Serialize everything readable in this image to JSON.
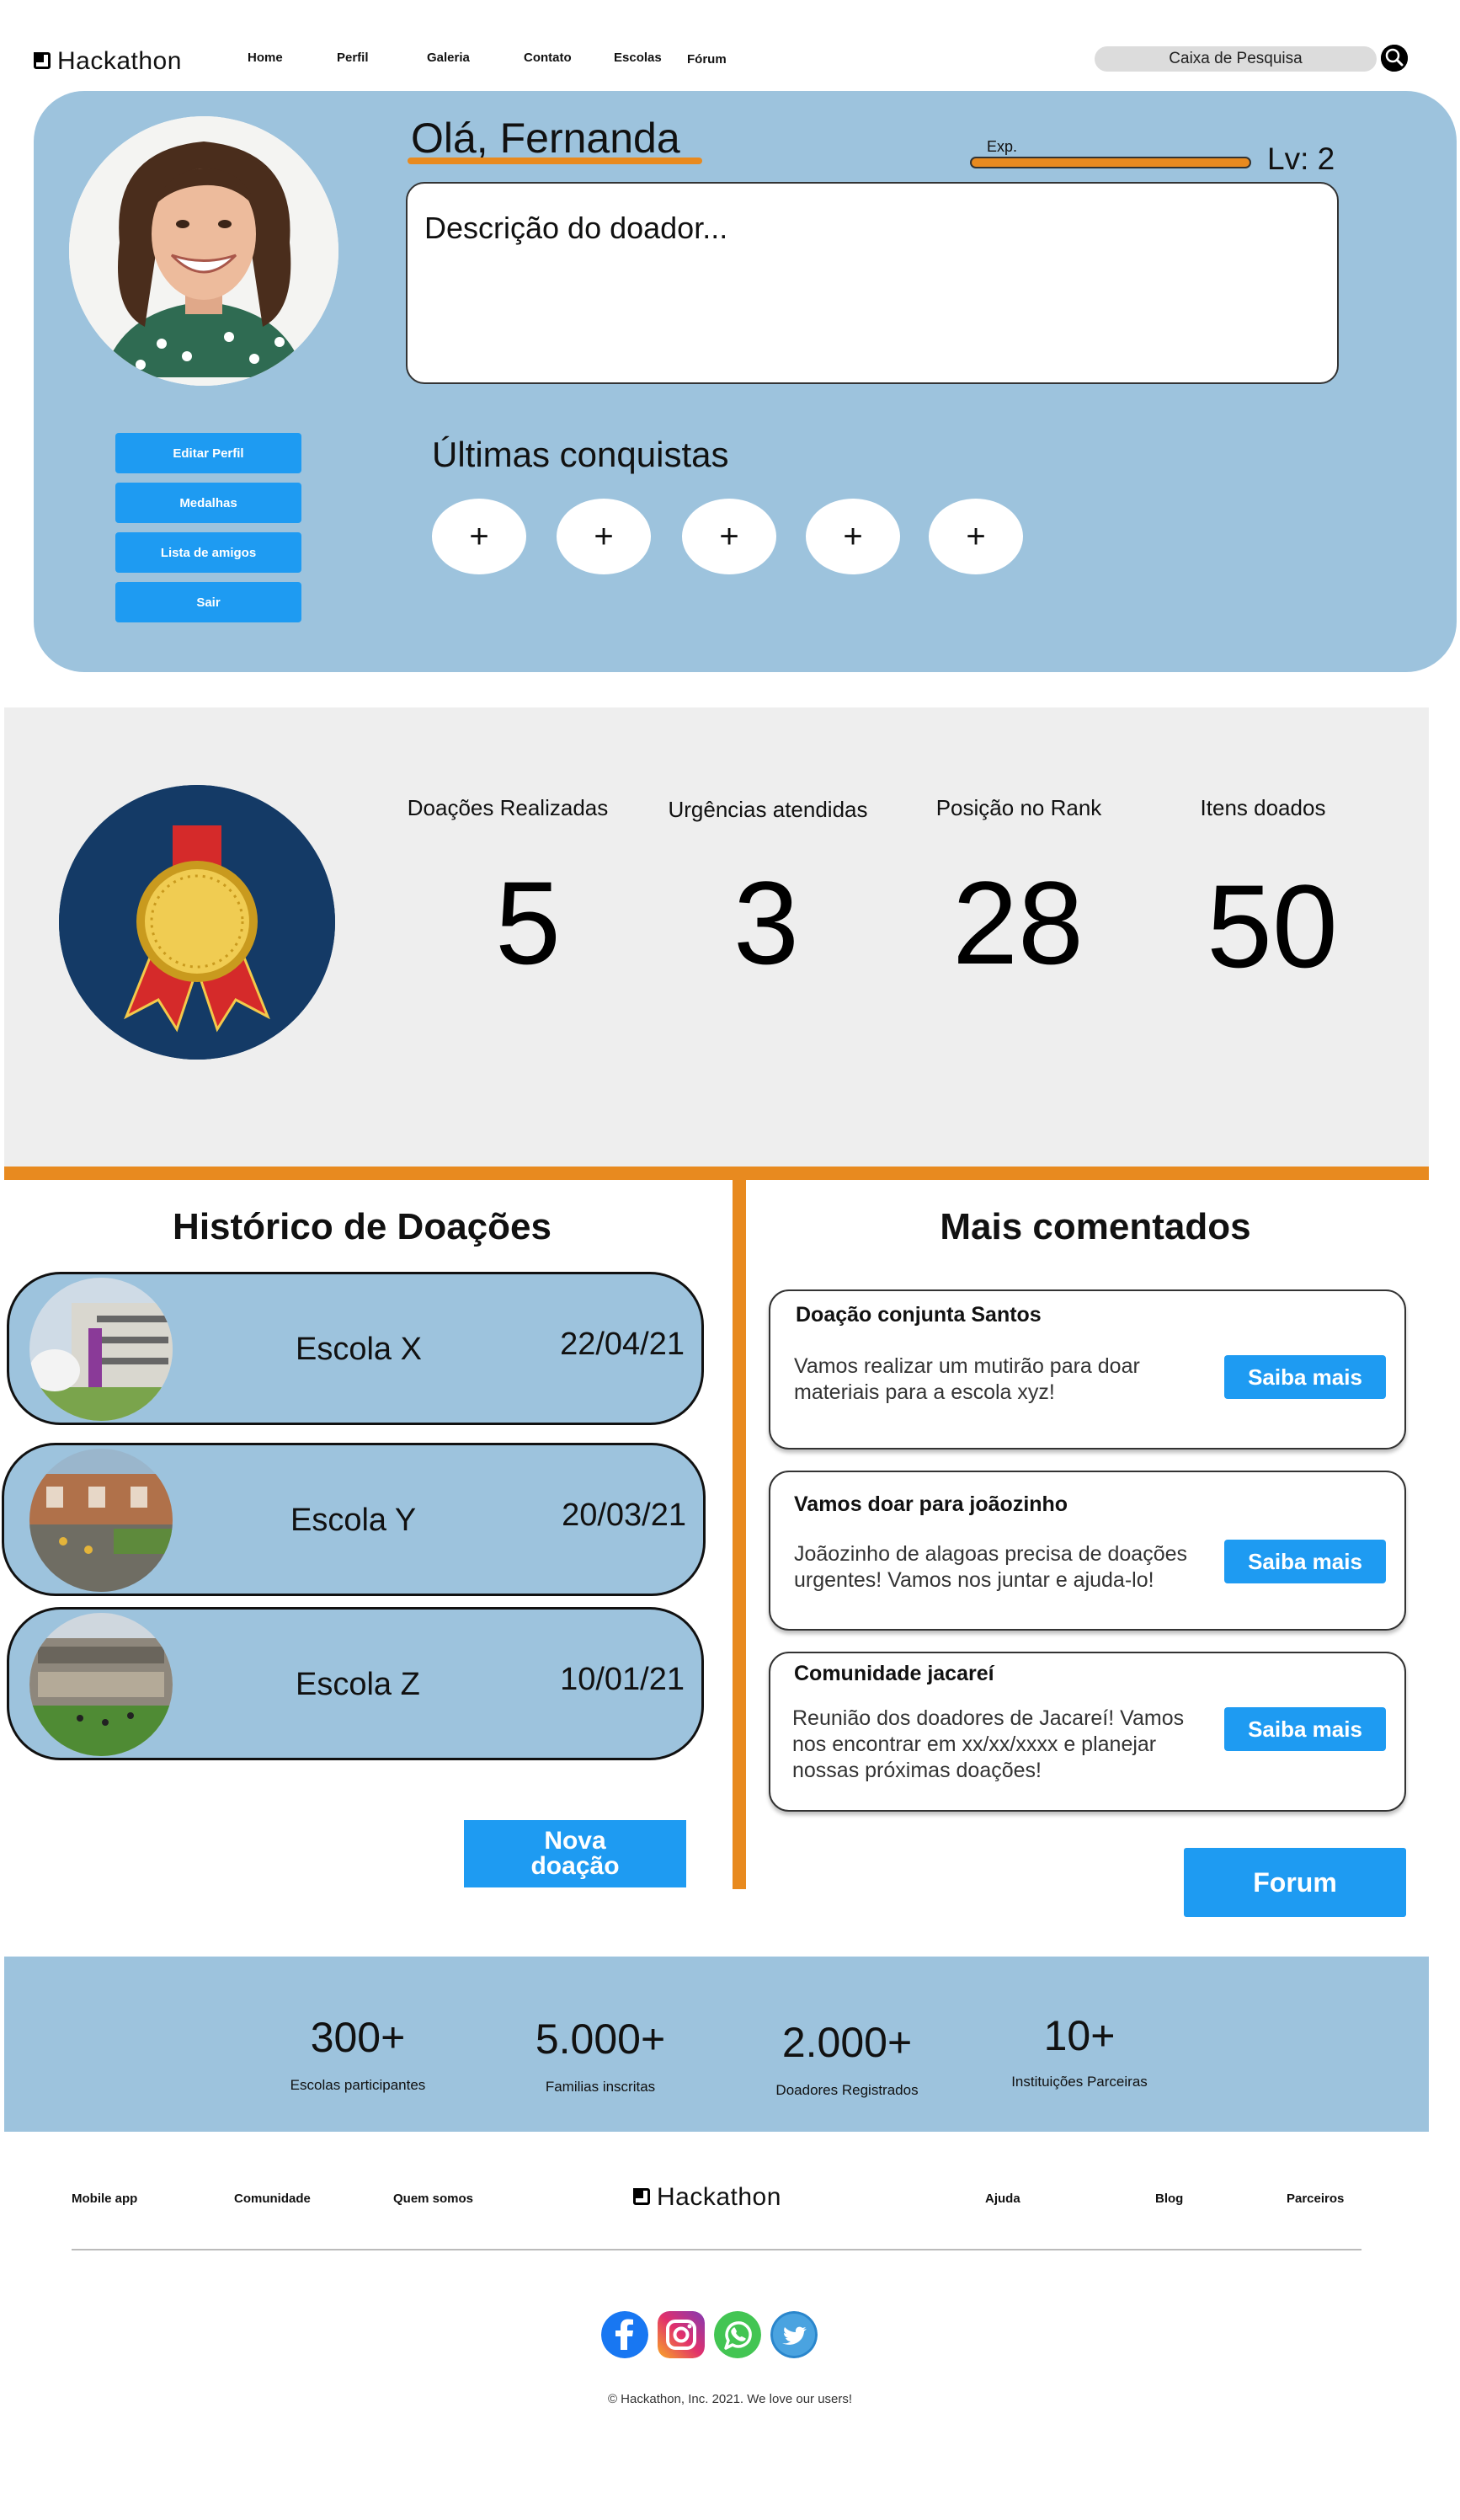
{
  "brand": {
    "name": "Hackathon"
  },
  "nav": {
    "links": [
      "Home",
      "Perfil",
      "Galeria",
      "Contato",
      "Escolas",
      "Fórum"
    ],
    "search_placeholder": "Caixa de Pesquisa"
  },
  "profile": {
    "greeting": "Olá, Fernanda",
    "exp_label": "Exp.",
    "exp_progress": 1.0,
    "level": "Lv: 2",
    "description": "Descrição do doador...",
    "buttons": [
      "Editar Perfil",
      "Medalhas",
      "Lista de amigos",
      "Sair"
    ],
    "achievements_title": "Últimas conquistas",
    "achievement_slots": [
      "+",
      "+",
      "+",
      "+",
      "+"
    ]
  },
  "stats": [
    {
      "label": "Doações Realizadas",
      "value": "5"
    },
    {
      "label": "Urgências atendidas",
      "value": "3"
    },
    {
      "label": "Posição no Rank",
      "value": "28"
    },
    {
      "label": "Itens doados",
      "value": "50"
    }
  ],
  "history": {
    "title": "Histórico de Doações",
    "items": [
      {
        "school": "Escola X",
        "date": "22/04/21"
      },
      {
        "school": "Escola Y",
        "date": "20/03/21"
      },
      {
        "school": "Escola Z",
        "date": "10/01/21"
      }
    ],
    "new_button": "Nova doação"
  },
  "comments": {
    "title": "Mais comentados",
    "items": [
      {
        "title": "Doação conjunta Santos",
        "text": "Vamos realizar um mutirão para doar materiais para a escola xyz!",
        "button": "Saiba mais"
      },
      {
        "title": "Vamos doar para joãozinho",
        "text": "Joãozinho de alagoas precisa de doações urgentes! Vamos nos juntar e ajuda-lo!",
        "button": "Saiba mais"
      },
      {
        "title": "Comunidade jacareí",
        "text": "Reunião dos doadores de Jacareí! Vamos nos encontrar em xx/xx/xxxx e planejar nossas próximas doações!",
        "button": "Saiba mais"
      }
    ],
    "forum_button": "Forum"
  },
  "counters": [
    {
      "value": "300+",
      "label": "Escolas participantes"
    },
    {
      "value": "5.000+",
      "label": "Familias inscritas"
    },
    {
      "value": "2.000+",
      "label": "Doadores Registrados"
    },
    {
      "value": "10+",
      "label": "Instituições Parceiras"
    }
  ],
  "footer": {
    "links_left": [
      "Mobile app",
      "Comunidade",
      "Quem somos"
    ],
    "links_right": [
      "Ajuda",
      "Blog",
      "Parceiros"
    ],
    "social_icons": [
      "facebook-icon",
      "instagram-icon",
      "whatsapp-icon",
      "twitter-icon"
    ],
    "copyright": "© Hackathon, Inc. 2021. We love our users!"
  },
  "colors": {
    "panel_blue": "#9dc3dd",
    "accent_orange": "#e88a1f",
    "button_blue": "#1e9bf2",
    "stats_gray": "#eeeeee",
    "medal_navy": "#143a66"
  }
}
